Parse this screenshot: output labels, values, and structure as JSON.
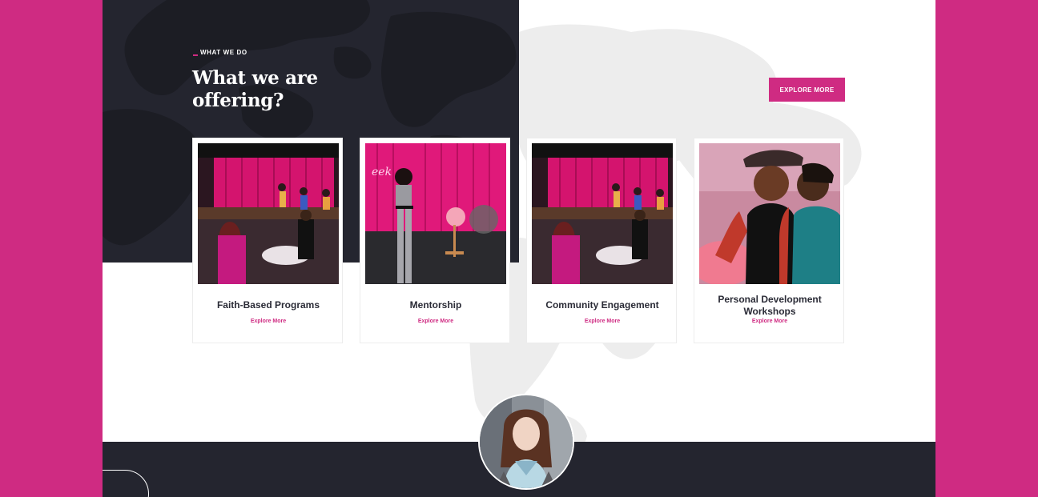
{
  "section": {
    "eyebrow": "What we do",
    "heading": "What we are offering?",
    "explore_button": "Explore More"
  },
  "cards": [
    {
      "title": "Faith-Based Programs",
      "link": "Explore More",
      "photo_icon": "event-stage-photo"
    },
    {
      "title": "Mentorship",
      "link": "Explore More",
      "photo_icon": "speaker-on-stage-photo"
    },
    {
      "title": "Community Engagement",
      "link": "Explore More",
      "photo_icon": "event-stage-photo"
    },
    {
      "title": "Personal Development Workshops",
      "link": "Explore More",
      "photo_icon": "two-women-smiling-photo"
    }
  ],
  "colors": {
    "accent": "#cf2b82",
    "dark": "#24252f",
    "text_dark": "#2a2b36",
    "map_light": "#ececec"
  }
}
